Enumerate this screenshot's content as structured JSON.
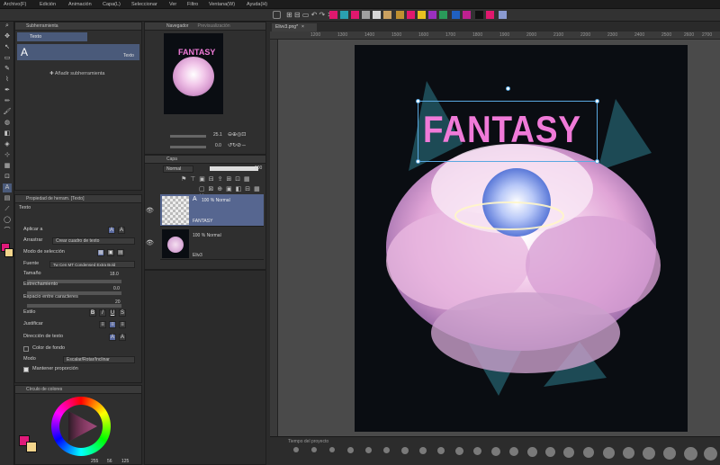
{
  "menu": [
    "Archivo(F)",
    "Edición",
    "Animación",
    "Capa(L)",
    "Seleccionar",
    "Ver",
    "Filtro",
    "Ventana(W)",
    "Ayuda(H)"
  ],
  "colors": {
    "pink": "#f07ad8",
    "cyan_box": "#5aa8e0",
    "accent": "#e01a7a",
    "canvas_bg": "#0a0d12"
  },
  "subtool": {
    "title": "Subherramienta",
    "item": "Texto",
    "label": "Texto",
    "add": "Añadir subherramienta"
  },
  "navigator": {
    "tab1": "Navegador",
    "tab2": "Previsualización",
    "zoom": "25.1",
    "angle": "0.0"
  },
  "props": {
    "title": "Propiedad de herram. [Texto]",
    "tool": "Texto",
    "apply_label": "Aplicar a",
    "drag_label": "Arrastrar",
    "drag_value": "Crear cuadro de texto",
    "select_label": "Modo de selección",
    "font_label": "Fuente",
    "font_value": "Tw Cen MT Condensed Extra Bold",
    "size_label": "Tamaño",
    "size_value": "18.0",
    "tracking_label": "Estrechamiento",
    "tracking_value": "0.0",
    "spacing_label": "Espacio entre caracteres",
    "spacing_value": "20",
    "style_label": "Estilo",
    "justify_label": "Justificar",
    "dir_label": "Dirección de texto",
    "bg_label": "Color de fondo",
    "mode_label": "Modo",
    "mode_value": "Escalar/Rotar/Inclinar",
    "keep_label": "Mantener proporción"
  },
  "colorwheel": {
    "title": "Círculo de colores",
    "h": "255",
    "s": "56",
    "v": "125"
  },
  "layers": {
    "title": "Capa",
    "blend": "Normal",
    "opacity": "100",
    "items": [
      {
        "opacity": "100 % Normal",
        "name": "FANTASY"
      },
      {
        "opacity": "100 % Normal",
        "name": "Eliv3"
      }
    ]
  },
  "document": {
    "tab": "Elivv3.png*",
    "canvas_text": "FANTASY",
    "timeline": "Tiempo del proyecto"
  },
  "ruler": [
    "1200",
    "1300",
    "1400",
    "1500",
    "1600",
    "1700",
    "1800",
    "1900",
    "2000",
    "2100",
    "2200",
    "2300",
    "2400",
    "2500",
    "2600",
    "2700"
  ]
}
